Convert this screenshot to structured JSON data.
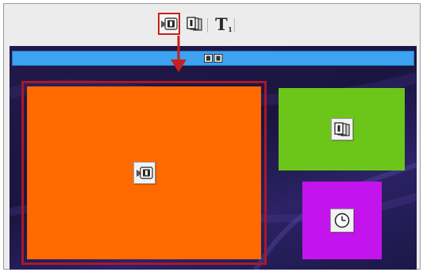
{
  "toolbar": {
    "buttons": [
      {
        "name": "single-media-zone",
        "icon": "video-zone-icon",
        "selected": true
      },
      {
        "name": "multi-media-zone",
        "icon": "multi-media-zone-icon",
        "selected": false
      },
      {
        "name": "text-zone",
        "icon": "text-zone-icon",
        "label": "T",
        "sub": "1",
        "selected": false
      }
    ]
  },
  "canvas": {
    "topbar_icon": "filmstrip-icon",
    "zones": [
      {
        "name": "main-zone",
        "color": "#ff6a00",
        "icon": "video-zone-icon",
        "selected": true
      },
      {
        "name": "green-zone",
        "color": "#6cc61a",
        "icon": "multi-media-zone-icon"
      },
      {
        "name": "purple-zone",
        "color": "#c414ee",
        "icon": "clock-icon"
      }
    ]
  },
  "colors": {
    "selection_red": "#c8201e",
    "topbar_blue": "#3da2f0",
    "canvas_bg": "#1a1540"
  }
}
